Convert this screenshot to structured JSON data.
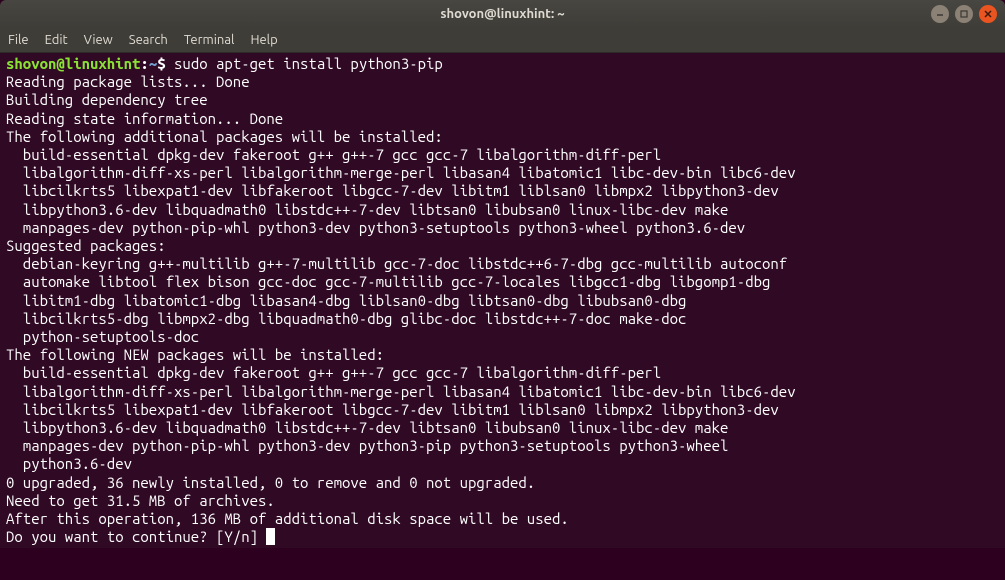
{
  "titlebar": {
    "title": "shovon@linuxhint: ~"
  },
  "menu": {
    "file": "File",
    "edit": "Edit",
    "view": "View",
    "search": "Search",
    "terminal": "Terminal",
    "help": "Help"
  },
  "prompt": {
    "userhost": "shovon@linuxhint",
    "sep1": ":",
    "path": "~",
    "sep2": "$"
  },
  "command": "sudo apt-get install python3-pip",
  "output": {
    "l1": "Reading package lists... Done",
    "l2": "Building dependency tree",
    "l3": "Reading state information... Done",
    "l4": "The following additional packages will be installed:",
    "l5": "  build-essential dpkg-dev fakeroot g++ g++-7 gcc gcc-7 libalgorithm-diff-perl",
    "l6": "  libalgorithm-diff-xs-perl libalgorithm-merge-perl libasan4 libatomic1 libc-dev-bin libc6-dev",
    "l7": "  libcilkrts5 libexpat1-dev libfakeroot libgcc-7-dev libitm1 liblsan0 libmpx2 libpython3-dev",
    "l8": "  libpython3.6-dev libquadmath0 libstdc++-7-dev libtsan0 libubsan0 linux-libc-dev make",
    "l9": "  manpages-dev python-pip-whl python3-dev python3-setuptools python3-wheel python3.6-dev",
    "l10": "Suggested packages:",
    "l11": "  debian-keyring g++-multilib g++-7-multilib gcc-7-doc libstdc++6-7-dbg gcc-multilib autoconf",
    "l12": "  automake libtool flex bison gcc-doc gcc-7-multilib gcc-7-locales libgcc1-dbg libgomp1-dbg",
    "l13": "  libitm1-dbg libatomic1-dbg libasan4-dbg liblsan0-dbg libtsan0-dbg libubsan0-dbg",
    "l14": "  libcilkrts5-dbg libmpx2-dbg libquadmath0-dbg glibc-doc libstdc++-7-doc make-doc",
    "l15": "  python-setuptools-doc",
    "l16": "The following NEW packages will be installed:",
    "l17": "  build-essential dpkg-dev fakeroot g++ g++-7 gcc gcc-7 libalgorithm-diff-perl",
    "l18": "  libalgorithm-diff-xs-perl libalgorithm-merge-perl libasan4 libatomic1 libc-dev-bin libc6-dev",
    "l19": "  libcilkrts5 libexpat1-dev libfakeroot libgcc-7-dev libitm1 liblsan0 libmpx2 libpython3-dev",
    "l20": "  libpython3.6-dev libquadmath0 libstdc++-7-dev libtsan0 libubsan0 linux-libc-dev make",
    "l21": "  manpages-dev python-pip-whl python3-dev python3-pip python3-setuptools python3-wheel",
    "l22": "  python3.6-dev",
    "l23": "0 upgraded, 36 newly installed, 0 to remove and 0 not upgraded.",
    "l24": "Need to get 31.5 MB of archives.",
    "l25": "After this operation, 136 MB of additional disk space will be used.",
    "l26": "Do you want to continue? [Y/n] "
  }
}
